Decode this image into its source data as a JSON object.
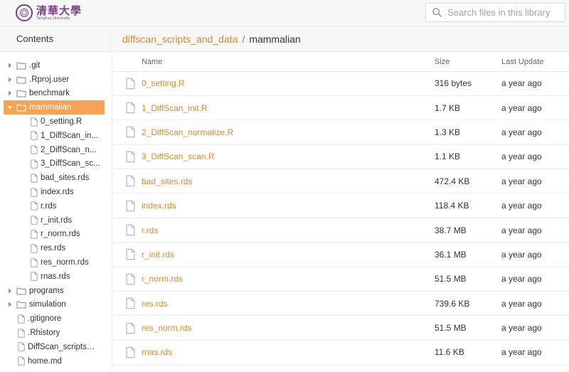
{
  "header": {
    "logo_cn": "清華大學",
    "logo_en": "Tsinghua University",
    "search_placeholder": "Search files in this library"
  },
  "sidebar": {
    "title": "Contents",
    "tree": [
      {
        "label": ".git",
        "type": "folder",
        "level": 0,
        "expanded": false,
        "selected": false
      },
      {
        "label": ".Rproj.user",
        "type": "folder",
        "level": 0,
        "expanded": false,
        "selected": false
      },
      {
        "label": "benchmark",
        "type": "folder",
        "level": 0,
        "expanded": false,
        "selected": false
      },
      {
        "label": "mammalian",
        "type": "folder",
        "level": 0,
        "expanded": true,
        "selected": true
      },
      {
        "label": "0_setting.R",
        "type": "file",
        "level": 1,
        "selected": false
      },
      {
        "label": "1_DiffScan_in...",
        "type": "file",
        "level": 1,
        "selected": false
      },
      {
        "label": "2_DiffScan_n...",
        "type": "file",
        "level": 1,
        "selected": false
      },
      {
        "label": "3_DiffScan_sc...",
        "type": "file",
        "level": 1,
        "selected": false
      },
      {
        "label": "bad_sites.rds",
        "type": "file",
        "level": 1,
        "selected": false
      },
      {
        "label": "index.rds",
        "type": "file",
        "level": 1,
        "selected": false
      },
      {
        "label": "r.rds",
        "type": "file",
        "level": 1,
        "selected": false
      },
      {
        "label": "r_init.rds",
        "type": "file",
        "level": 1,
        "selected": false
      },
      {
        "label": "r_norm.rds",
        "type": "file",
        "level": 1,
        "selected": false
      },
      {
        "label": "res.rds",
        "type": "file",
        "level": 1,
        "selected": false
      },
      {
        "label": "res_norm.rds",
        "type": "file",
        "level": 1,
        "selected": false
      },
      {
        "label": "rnas.rds",
        "type": "file",
        "level": 1,
        "selected": false
      },
      {
        "label": "programs",
        "type": "folder",
        "level": 0,
        "expanded": false,
        "selected": false
      },
      {
        "label": "simulation",
        "type": "folder",
        "level": 0,
        "expanded": false,
        "selected": false
      },
      {
        "label": ".gitignore",
        "type": "file",
        "level": 0,
        "selected": false
      },
      {
        "label": ".Rhistory",
        "type": "file",
        "level": 0,
        "selected": false
      },
      {
        "label": "DiffScan_scripts_...",
        "type": "file",
        "level": 0,
        "selected": false
      },
      {
        "label": "home.md",
        "type": "file",
        "level": 0,
        "selected": false
      }
    ]
  },
  "breadcrumb": {
    "parent": "diffscan_scripts_and_data",
    "separator": "/",
    "current": "mammalian"
  },
  "table": {
    "headers": {
      "name": "Name",
      "size": "Size",
      "updated": "Last Update"
    },
    "rows": [
      {
        "name": "0_setting.R",
        "size": "316 bytes",
        "updated": "a year ago"
      },
      {
        "name": "1_DiffScan_init.R",
        "size": "1.7 KB",
        "updated": "a year ago"
      },
      {
        "name": "2_DiffScan_normalize.R",
        "size": "1.3 KB",
        "updated": "a year ago"
      },
      {
        "name": "3_DiffScan_scan.R",
        "size": "1.1 KB",
        "updated": "a year ago"
      },
      {
        "name": "bad_sites.rds",
        "size": "472.4 KB",
        "updated": "a year ago"
      },
      {
        "name": "index.rds",
        "size": "118.4 KB",
        "updated": "a year ago"
      },
      {
        "name": "r.rds",
        "size": "38.7 MB",
        "updated": "a year ago"
      },
      {
        "name": "r_init.rds",
        "size": "36.1 MB",
        "updated": "a year ago"
      },
      {
        "name": "r_norm.rds",
        "size": "51.5 MB",
        "updated": "a year ago"
      },
      {
        "name": "res.rds",
        "size": "739.6 KB",
        "updated": "a year ago"
      },
      {
        "name": "res_norm.rds",
        "size": "51.5 MB",
        "updated": "a year ago"
      },
      {
        "name": "rnas.rds",
        "size": "11.6 KB",
        "updated": "a year ago"
      }
    ]
  },
  "colors": {
    "accent": "#e08a2c",
    "selected_bg": "#f7a356",
    "brand": "#7a3f86"
  },
  "icons": {
    "folder": "folder-icon",
    "file": "file-icon",
    "caret_right": "caret-right-icon",
    "caret_down": "caret-down-icon",
    "search": "search-icon"
  }
}
